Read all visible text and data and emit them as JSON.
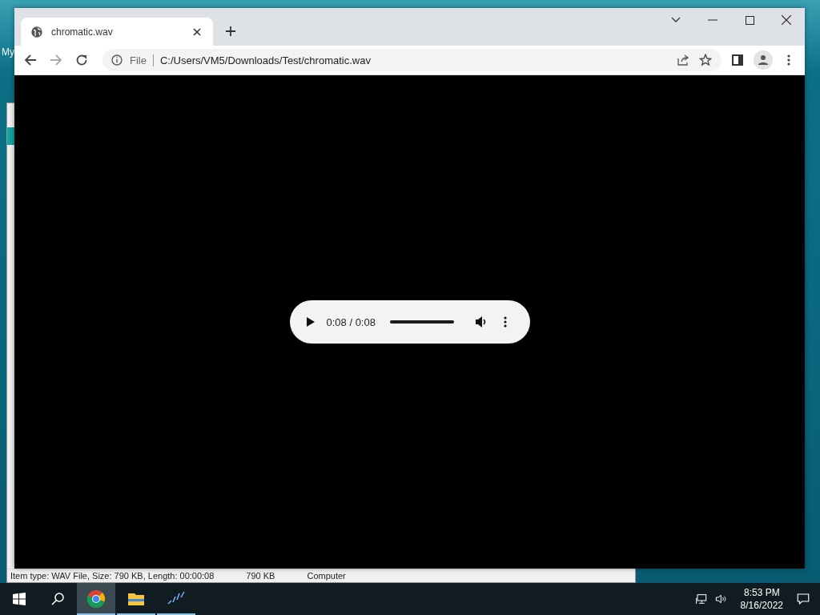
{
  "desktop": {
    "icon_label": "My"
  },
  "background_window": {
    "status_items": [
      {
        "text": "Item type: WAV File, Size: 790 KB, Length: 00:00:08"
      },
      {
        "text": "790 KB"
      },
      {
        "text": "Computer"
      }
    ]
  },
  "browser": {
    "tabs": [
      {
        "title": "chromatic.wav",
        "selected": true
      }
    ],
    "address": {
      "scheme_label": "File",
      "url": "C:/Users/VM5/Downloads/Test/chromatic.wav"
    },
    "forward_disabled": true
  },
  "audio_player": {
    "time": "0:08 / 0:08",
    "level": 1
  },
  "taskbar": {
    "apps": [
      {
        "kind": "chrome",
        "selected": true
      },
      {
        "kind": "folder",
        "selected": false
      },
      {
        "kind": "audio",
        "selected": false
      }
    ],
    "clock": {
      "time": "8:53 PM",
      "date": "8/16/2022"
    }
  }
}
